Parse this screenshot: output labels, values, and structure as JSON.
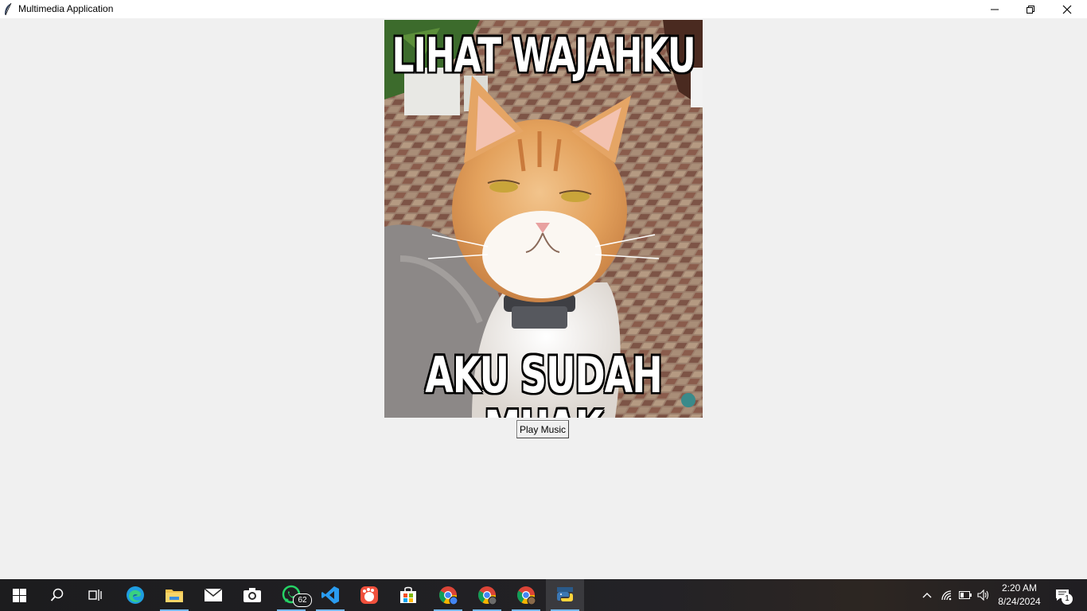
{
  "window": {
    "title": "Multimedia Application",
    "controls": {
      "minimize_icon": "minimize-icon",
      "maximize_icon": "restore-icon",
      "close_icon": "close-icon"
    }
  },
  "main": {
    "image": {
      "top_caption": "LIHAT WAJAHKU",
      "bottom_caption": "AKU SUDAH MUAK"
    },
    "play_button_label": "Play Music"
  },
  "taskbar": {
    "items": [
      {
        "name": "start",
        "icon": "windows-logo-icon"
      },
      {
        "name": "search",
        "icon": "search-icon"
      },
      {
        "name": "task-view",
        "icon": "task-view-icon"
      },
      {
        "name": "edge",
        "icon": "edge-icon"
      },
      {
        "name": "file-explorer",
        "icon": "folder-icon"
      },
      {
        "name": "mail",
        "icon": "mail-icon"
      },
      {
        "name": "camera",
        "icon": "camera-icon"
      },
      {
        "name": "whatsapp",
        "icon": "whatsapp-icon",
        "badge": "62"
      },
      {
        "name": "vscode",
        "icon": "vscode-icon"
      },
      {
        "name": "app-red",
        "icon": "app-icon"
      },
      {
        "name": "store",
        "icon": "store-icon"
      },
      {
        "name": "chrome-1",
        "icon": "chrome-icon"
      },
      {
        "name": "chrome-2",
        "icon": "chrome-icon"
      },
      {
        "name": "chrome-3",
        "icon": "chrome-icon"
      },
      {
        "name": "python",
        "icon": "python-icon",
        "active": true
      }
    ],
    "tray": {
      "icons": [
        "chevron-up-icon",
        "wifi-icon",
        "battery-icon",
        "volume-icon"
      ],
      "time": "2:20 AM",
      "date": "8/24/2024",
      "notification_count": "1"
    },
    "accent_color": "#76b9ed"
  }
}
